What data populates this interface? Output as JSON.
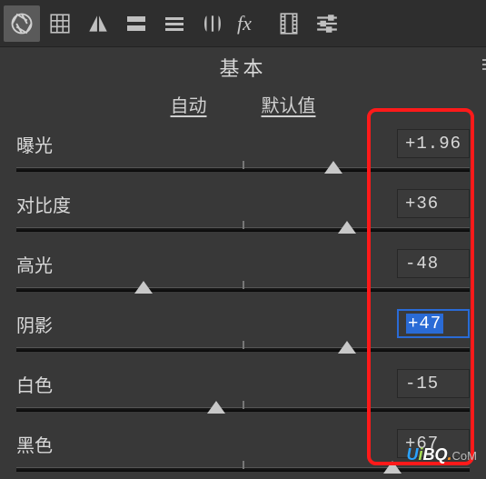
{
  "toolbar": {
    "icons": [
      "aperture",
      "grid",
      "mirror",
      "bars-h",
      "bars-v",
      "lens",
      "fx",
      "filmstrip",
      "sliders"
    ]
  },
  "section_title": "基本",
  "mode": {
    "auto": "自动",
    "default": "默认值"
  },
  "sliders": [
    {
      "label": "曝光",
      "value": "+1.96",
      "pos": 70,
      "focused": false
    },
    {
      "label": "对比度",
      "value": "+36",
      "pos": 73,
      "focused": false
    },
    {
      "label": "高光",
      "value": "-48",
      "pos": 28,
      "focused": false
    },
    {
      "label": "阴影",
      "value": "+47",
      "pos": 73,
      "focused": true
    },
    {
      "label": "白色",
      "value": "-15",
      "pos": 44,
      "focused": false
    },
    {
      "label": "黑色",
      "value": "+67",
      "pos": 83,
      "focused": false
    }
  ],
  "watermark": {
    "u": "U",
    "i": "i",
    "bq": "BQ",
    "dot": ".",
    "com": "CoM"
  },
  "colors": {
    "accent": "#2a6bd6",
    "highlight_border": "#ff1a1a",
    "bg": "#383838"
  }
}
